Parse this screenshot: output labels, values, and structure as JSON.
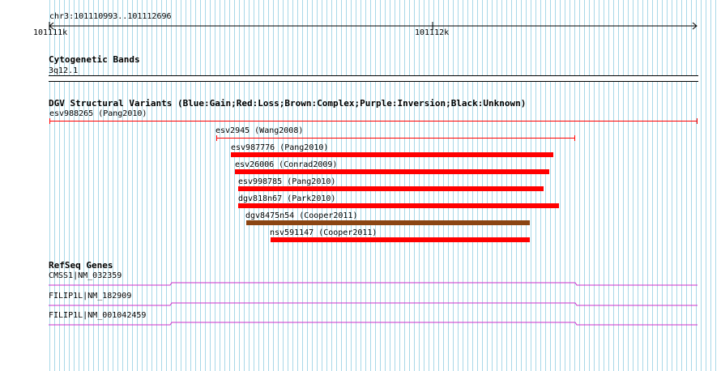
{
  "ruler": {
    "location": "chr3:101110993..101112696",
    "ticks": [
      "101111k",
      "101112k"
    ]
  },
  "cytoband": {
    "title": "Cytogenetic Bands",
    "band": "3q12.1"
  },
  "dgv": {
    "title": "DGV Structural Variants (Blue:Gain;Red:Loss;Brown:Complex;Purple:Inversion;Black:Unknown)",
    "variants": [
      {
        "label": "esv988265 (Pang2010)",
        "type": "loss",
        "style": "line"
      },
      {
        "label": "esv2945 (Wang2008)",
        "type": "loss",
        "style": "line"
      },
      {
        "label": "esv987776 (Pang2010)",
        "type": "loss",
        "style": "bar"
      },
      {
        "label": "esv26006 (Conrad2009)",
        "type": "loss",
        "style": "bar"
      },
      {
        "label": "esv998785 (Pang2010)",
        "type": "loss",
        "style": "bar"
      },
      {
        "label": "dgv818n67 (Park2010)",
        "type": "loss",
        "style": "bar"
      },
      {
        "label": "dgv8475n54 (Cooper2011)",
        "type": "complex",
        "style": "bar"
      },
      {
        "label": "nsv591147 (Cooper2011)",
        "type": "loss",
        "style": "bar"
      }
    ]
  },
  "refseq": {
    "title": "RefSeq Genes",
    "genes": [
      {
        "label": "CMSS1|NM_032359"
      },
      {
        "label": "FILIP1L|NM_182909"
      },
      {
        "label": "FILIP1L|NM_001042459"
      }
    ]
  },
  "colors": {
    "grid": "#a8d8e8",
    "loss": "#ff0000",
    "complex": "#8b4513",
    "gene": "#cc33cc",
    "rule": "#000000"
  }
}
